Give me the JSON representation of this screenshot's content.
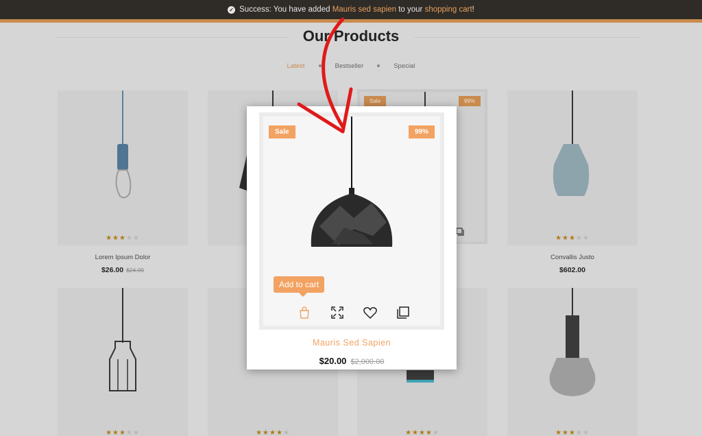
{
  "alert": {
    "prefix": "Success: You have added ",
    "product_link": "Mauris sed sapien",
    "middle": " to your ",
    "cart_link": "shopping cart",
    "suffix": "!"
  },
  "section": {
    "title": "Our Products",
    "tabs": [
      "Latest",
      "Bestseller",
      "Special"
    ]
  },
  "products": [
    {
      "name": "Lorem Ipsum Dolor",
      "price": "$26.00",
      "old_price": "$24.00",
      "rating": 3
    },
    {
      "name": "Convallis Justo",
      "price": "$602.00",
      "old_price": "",
      "rating": 3
    }
  ],
  "background_badges": {
    "sale": "Sale",
    "percent": "99%"
  },
  "popup": {
    "sale_badge": "Sale",
    "discount_badge": "99%",
    "add_to_cart": "Add to cart",
    "name": "Mauris Sed Sapien",
    "price": "$20.00",
    "old_price": "$2,000.00",
    "icons": [
      "shopping-bag-icon",
      "expand-icon",
      "heart-icon",
      "compare-icon"
    ]
  },
  "colors": {
    "accent": "#f2a261",
    "dark_bar": "#2f2b27",
    "star": "#b07b1b"
  }
}
